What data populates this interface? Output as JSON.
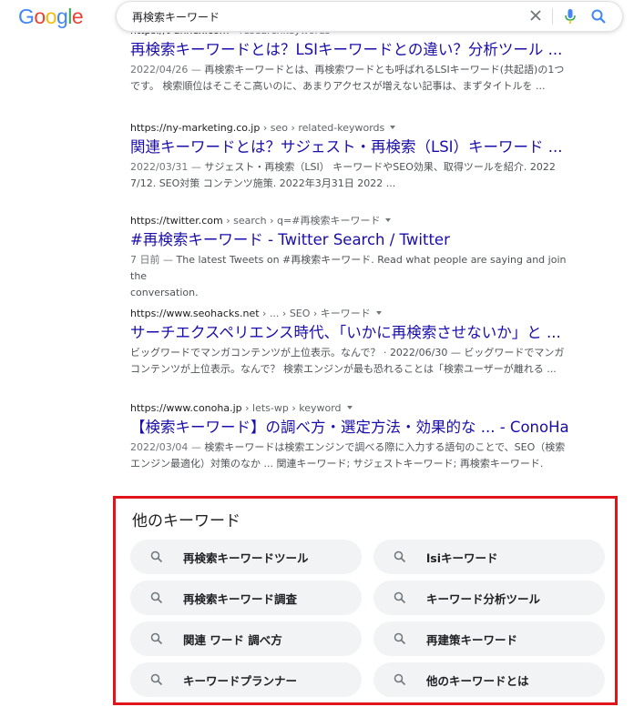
{
  "logo": {
    "letters": [
      "G",
      "o",
      "o",
      "g",
      "l",
      "e"
    ]
  },
  "search": {
    "query": "再検索キーワード",
    "clear_icon": "close-icon",
    "mic_icon": "microphone-icon",
    "search_icon": "search-icon"
  },
  "results": [
    {
      "cite_domain": "https://t-annex.com",
      "cite_path": " › researchkeywords",
      "title": "再検索キーワードとは？LSIキーワードとの違い？分析ツール ...",
      "snippet_date": "2022/04/26 — ",
      "snippet_line1": "再検索キーワードとは、再検索ワードとも呼ばれるLSIキーワード(共起語)の1つ",
      "snippet_line2": "です。 検索順位はそこそこ高いのに、あまりアクセスが増えない記事は、まずタイトルを ..."
    },
    {
      "cite_domain": "https://ny-marketing.co.jp",
      "cite_path": " › seo › related-keywords",
      "title": "関連キーワードとは？サジェスト・再検索（LSI）キーワード ...",
      "snippet_date": "2022/03/31 — ",
      "snippet_line1": "サジェスト・再検索（LSI） キーワードやSEO効果、取得ツールを紹介. 2022",
      "snippet_line2": "7/12. SEO対策 コンテンツ施策. 2022年3月31日 2022 ..."
    },
    {
      "cite_domain": "https://twitter.com",
      "cite_path": " › search › q=#再検索キーワード",
      "title": "#再検索キーワード - Twitter Search / Twitter",
      "snippet_date": "7 日前 — ",
      "snippet_line1": "The latest Tweets on #再検索キーワード. Read what people are saying and join the",
      "snippet_line2": "conversation."
    },
    {
      "cite_domain": "https://www.seohacks.net",
      "cite_path": " › ... › SEO › キーワード",
      "title": "サーチエクスペリエンス時代、「いかに再検索させないか」と ...",
      "snippet_date": "",
      "snippet_line1": "ビッグワードでマンガコンテンツが上位表示。なんで？ · 2022/06/30 — ビッグワードでマンガ",
      "snippet_line2": "コンテンツが上位表示。なんで？ 検索エンジンが最も恐れることは「検索ユーザーが離れる ..."
    },
    {
      "cite_domain": "https://www.conoha.jp",
      "cite_path": " › lets-wp › keyword",
      "title": "【検索キーワード】の調べ方・選定方法・効果的な ... - ConoHa",
      "snippet_date": "2022/03/04 — ",
      "snippet_line1": "検索キーワードは検索エンジンで調べる際に入力する語句のことで、SEO（検索",
      "snippet_line2": "エンジン最適化）対策のなか ... 関連キーワード; サジェストキーワード; 再検索キーワード."
    }
  ],
  "related": {
    "title": "他のキーワード",
    "icon": "search-icon",
    "chips": [
      "再検索キーワードツール",
      "lsiキーワード",
      "再検索キーワード調査",
      "キーワード分析ツール",
      "関連 ワード 調べ方",
      "再建策キーワード",
      "キーワードプランナー",
      "他のキーワードとは"
    ]
  },
  "colors": {
    "link": "#1a0dab",
    "highlight_border": "#e0141b",
    "chip_bg": "#f1f3f4",
    "logo_blue": "#4285f4",
    "logo_red": "#ea4335",
    "logo_yellow": "#fbbc05",
    "logo_green": "#34a853"
  }
}
